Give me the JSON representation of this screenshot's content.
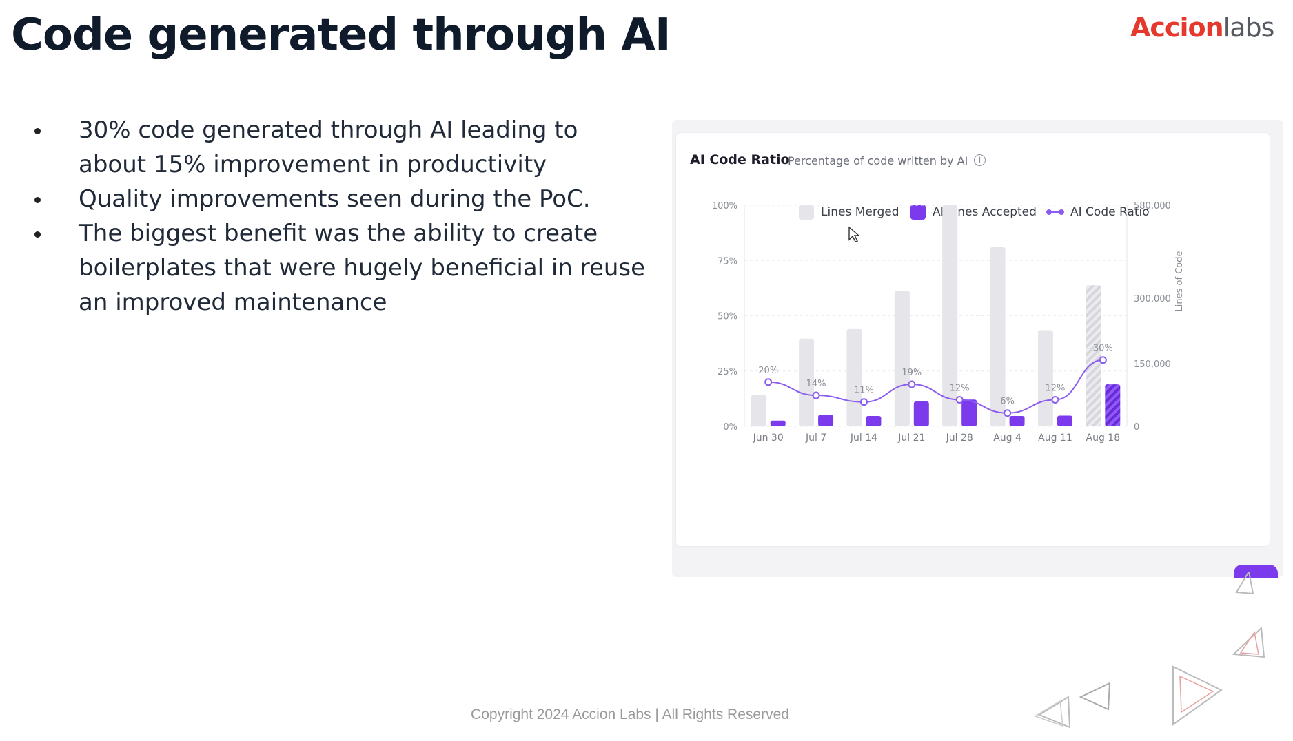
{
  "slide": {
    "title": "Code generated through AI",
    "logo_text_red": "Accion",
    "logo_text_gray": "labs",
    "bullets": [
      "30% code generated through AI leading to about 15% improvement in productivity",
      "Quality improvements seen during the PoC.",
      "The biggest benefit was the ability to create boilerplates that were hugely beneficial in reuse an improved maintenance"
    ],
    "copyright": "Copyright 2024 Accion Labs | All Rights Reserved"
  },
  "card": {
    "title": "AI Code Ratio",
    "subtitle": "Percentage of code written by AI",
    "info_icon": "info-icon"
  },
  "colors": {
    "title": "#0f1a2b",
    "lines_merged": "#e6e6ea",
    "ai_lines_accepted": "#7c3aed",
    "ai_code_ratio": "#8a5cf0",
    "logo_red": "#e6392e"
  },
  "chart_data": {
    "type": "bar",
    "categories": [
      "Jun 30",
      "Jul 7",
      "Jul 14",
      "Jul 21",
      "Jul 28",
      "Aug 4",
      "Aug 11",
      "Aug 18"
    ],
    "series": [
      {
        "name": "Lines Merged",
        "axis": "right",
        "values": [
          82000,
          230000,
          255000,
          355000,
          580000,
          470000,
          252000,
          370000
        ],
        "last_hatched": true
      },
      {
        "name": "AI Lines Accepted",
        "axis": "right",
        "values": [
          15000,
          30000,
          27000,
          65000,
          70000,
          27000,
          28000,
          110000
        ],
        "last_hatched": true
      },
      {
        "name": "AI Code Ratio",
        "type": "line",
        "axis": "left",
        "values": [
          20,
          14,
          11,
          19,
          12,
          6,
          12,
          30
        ],
        "labels": [
          "20%",
          "14%",
          "11%",
          "19%",
          "12%",
          "6%",
          "12%",
          "30%"
        ]
      }
    ],
    "left_axis": {
      "ticks": [
        "100%",
        "75%",
        "50%",
        "25%",
        "0%"
      ],
      "ylim": [
        0,
        100
      ]
    },
    "right_axis": {
      "ticks": [
        "580,000",
        "300,000",
        "150,000",
        "0"
      ],
      "label": "Lines of Code",
      "ylim": [
        0,
        580000
      ]
    },
    "legend_position": "top-center",
    "grid": true
  }
}
